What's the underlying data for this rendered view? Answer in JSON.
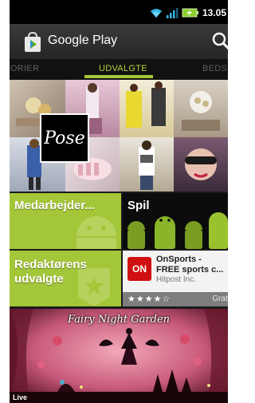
{
  "status_bar": {
    "time": "13.05",
    "icons": [
      "wifi-icon",
      "signal-icon",
      "battery-charging-icon"
    ]
  },
  "action_bar": {
    "title": "Google Play",
    "logo_icon": "play-store-bag-icon",
    "search_icon": "search-icon"
  },
  "tabs": {
    "left": "GORIER",
    "active": "UDVALGTE",
    "right": "BEDST",
    "active_color": "#a4c639"
  },
  "feature": {
    "logo_text": "Pose"
  },
  "categories": {
    "staff_picks": "Medarbejder...",
    "games": "Spil",
    "editors_choice_line1": "Redaktørens",
    "editors_choice_line2": "udvalgte",
    "tile_color": "#a4c639"
  },
  "app_card": {
    "icon_text": "ON",
    "name_line1": "OnSports -",
    "name_line2": "FREE sports c...",
    "developer": "Hitpost Inc.",
    "rating": "★★★★☆",
    "rating_value": 4,
    "price": "Grati"
  },
  "banner": {
    "title": "Fairy Night Garden",
    "tag": "Live"
  }
}
